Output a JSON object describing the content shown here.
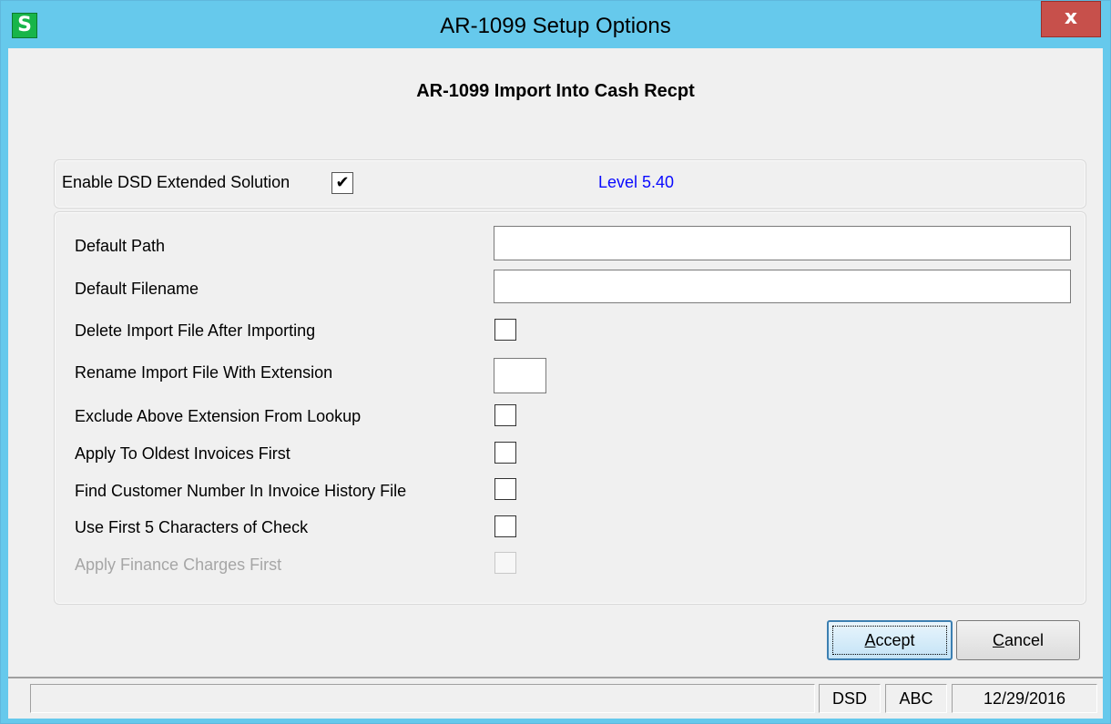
{
  "window": {
    "app_icon": "S",
    "title": "AR-1099 Setup Options",
    "close_glyph": "x"
  },
  "heading": "AR-1099 Import Into Cash Recpt",
  "enable": {
    "label": "Enable DSD Extended Solution",
    "checked": true,
    "check_glyph": "✔",
    "level": "Level  5.40"
  },
  "fields": {
    "default_path_label": "Default Path",
    "default_path_value": "",
    "default_filename_label": "Default Filename",
    "default_filename_value": "",
    "delete_import_label": "Delete Import File After Importing",
    "rename_import_label": "Rename Import File With Extension",
    "rename_extension_value": "",
    "exclude_extension_label": "Exclude Above Extension From Lookup",
    "apply_oldest_label": "Apply To Oldest Invoices First",
    "find_customer_label": "Find Customer Number In Invoice History File",
    "use_first5_label": "Use First 5 Characters of Check",
    "apply_finance_label": "Apply Finance Charges First"
  },
  "buttons": {
    "accept_hotkey": "A",
    "accept_rest": "ccept",
    "cancel_hotkey": "C",
    "cancel_rest": "ancel"
  },
  "statusbar": {
    "message": "",
    "company_code": "DSD",
    "company": "ABC",
    "date": "12/29/2016"
  },
  "colors": {
    "titlebar": "#66c9ec",
    "close_button": "#c7504b",
    "level_text": "#0a0aff",
    "app_icon": "#18b54a"
  }
}
